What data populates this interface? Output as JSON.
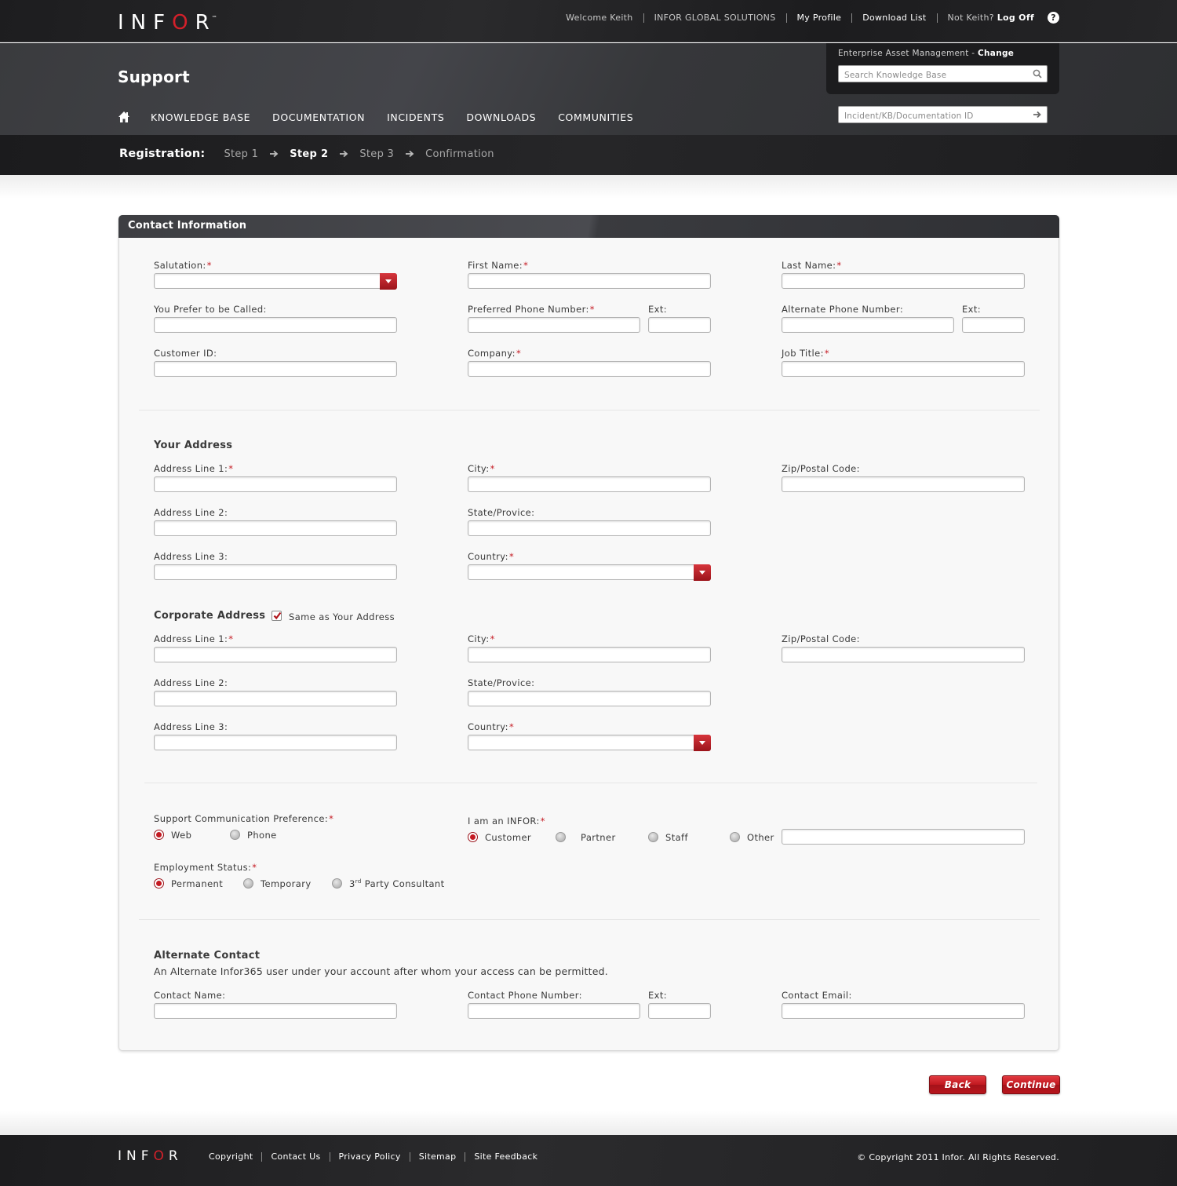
{
  "header": {
    "logo_text": "INFOR",
    "logo_tm": "™",
    "welcome": "Welcome Keith",
    "company": "INFOR GLOBAL SOLUTIONS",
    "my_profile": "My Profile",
    "download_list": "Download List",
    "not_user": "Not Keith?",
    "log_off": "Log Off",
    "help_icon": "?",
    "page_title": "Support",
    "nav": [
      "KNOWLEDGE BASE",
      "DOCUMENTATION",
      "INCIDENTS",
      "DOWNLOADS",
      "COMMUNITIES"
    ],
    "product": "Enterprise Asset Management",
    "product_separator": " - ",
    "change": "Change",
    "kb_search_placeholder": "Search Knowledge Base",
    "id_search_placeholder": "Incident/KB/Documentation ID"
  },
  "registration": {
    "label": "Registration:",
    "steps": [
      "Step 1",
      "Step 2",
      "Step 3",
      "Confirmation"
    ],
    "active_step": 1
  },
  "card": {
    "title": "Contact Information",
    "contact": {
      "salutation": "Salutation:",
      "first_name": "First Name:",
      "last_name": "Last Name:",
      "preferred_name": "You Prefer to be Called:",
      "preferred_phone": "Preferred Phone Number:",
      "ext": "Ext:",
      "alternate_phone": "Alternate Phone Number:",
      "customer_id": "Customer ID:",
      "company": "Company:",
      "job_title": "Job Title:"
    },
    "your_address": {
      "title": "Your Address",
      "line1": "Address Line 1:",
      "line2": "Address Line 2:",
      "line3": "Address Line 3:",
      "city": "City:",
      "state": "State/Provice:",
      "country": "Country:",
      "zip": "Zip/Postal Code:"
    },
    "corporate_address": {
      "title": "Corporate Address",
      "same_as": "Same as Your Address",
      "same_as_checked": true,
      "line1": "Address Line 1:",
      "line2": "Address Line 2:",
      "line3": "Address Line 3:",
      "city": "City:",
      "state": "State/Provice:",
      "country": "Country:",
      "zip": "Zip/Postal Code:"
    },
    "preferences": {
      "comm_label": "Support Communication Preference:",
      "comm_options": [
        "Web",
        "Phone"
      ],
      "comm_selected": "Web",
      "infor_label": "I am an INFOR:",
      "infor_options": [
        "Customer",
        "Partner",
        "Staff",
        "Other"
      ],
      "infor_selected": "Customer",
      "employment_label": "Employment Status:",
      "employment_options": [
        "Permanent",
        "Temporary",
        "3rd Party Consultant"
      ],
      "employment_selected": "Permanent"
    },
    "alternate": {
      "title": "Alternate Contact",
      "description": "An Alternate Infor365 user under your account after whom your access can be permitted.",
      "contact_name": "Contact Name:",
      "contact_phone": "Contact Phone Number:",
      "ext": "Ext:",
      "contact_email": "Contact Email:"
    }
  },
  "buttons": {
    "back": "Back",
    "continue": "Continue"
  },
  "footer": {
    "logo_text": "INFOR",
    "links": [
      "Copyright",
      "Contact Us",
      "Privacy Policy",
      "Sitemap",
      "Site Feedback"
    ],
    "copyright": "© Copyright  2011 Infor. All Rights Reserved."
  },
  "icons": [
    "home-icon",
    "search-icon",
    "arrow-right-icon",
    "help-icon",
    "chevron-down-icon",
    "checkmark-icon"
  ],
  "colors": {
    "accent_red": "#c41a22",
    "header_dark": "#1d1d1f",
    "card_bg": "#f8f8f8"
  }
}
